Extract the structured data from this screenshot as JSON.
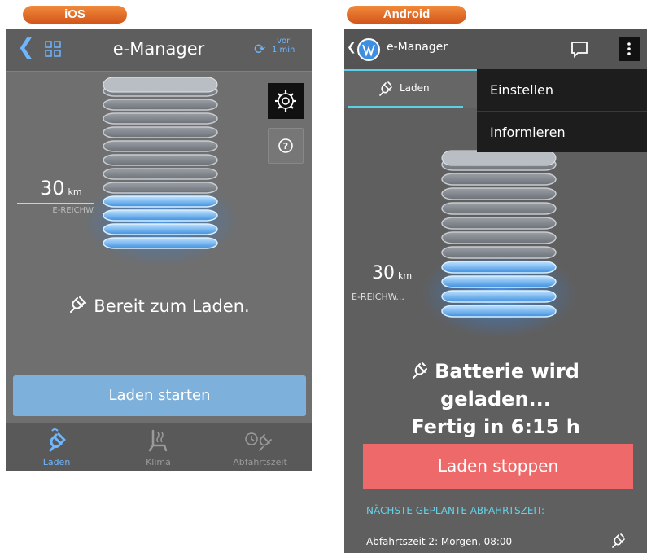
{
  "labels": {
    "ios": "iOS",
    "android": "Android"
  },
  "colors": {
    "accent_ios": "#6eb6ff",
    "accent_android": "#5dd0e6",
    "stop_button": "#ee6a6a",
    "label_pill": "#e8722a"
  },
  "ios": {
    "header": {
      "title": "e-Manager",
      "update_line1": "vor",
      "update_line2": "1 min"
    },
    "range": {
      "value": "30",
      "unit": "km",
      "label": "E-REICHW."
    },
    "status": "Bereit zum Laden.",
    "start_button": "Laden starten",
    "tabs": [
      {
        "label": "Laden",
        "icon": "charging-plug-icon",
        "active": true
      },
      {
        "label": "Klima",
        "icon": "seat-heating-icon",
        "active": false
      },
      {
        "label": "Abfahrtszeit",
        "icon": "clock-plug-icon",
        "active": false
      }
    ]
  },
  "android": {
    "header": {
      "title": "e-Manager"
    },
    "tab": {
      "label": "Laden",
      "icon": "charging-plug-icon"
    },
    "menu": [
      {
        "label": "Einstellen"
      },
      {
        "label": "Informieren"
      }
    ],
    "range": {
      "value": "30",
      "unit": "km",
      "label": "E-REICHW..."
    },
    "status": {
      "line1": "Batterie wird",
      "line2": "geladen...",
      "line3": "Fertig in 6:15 h"
    },
    "stop_button": "Laden stoppen",
    "next_departure_label": "NÄCHSTE GEPLANTE ABFAHRTSZEIT:",
    "departure": "Abfahrtszeit 2: Morgen, 08:00"
  }
}
